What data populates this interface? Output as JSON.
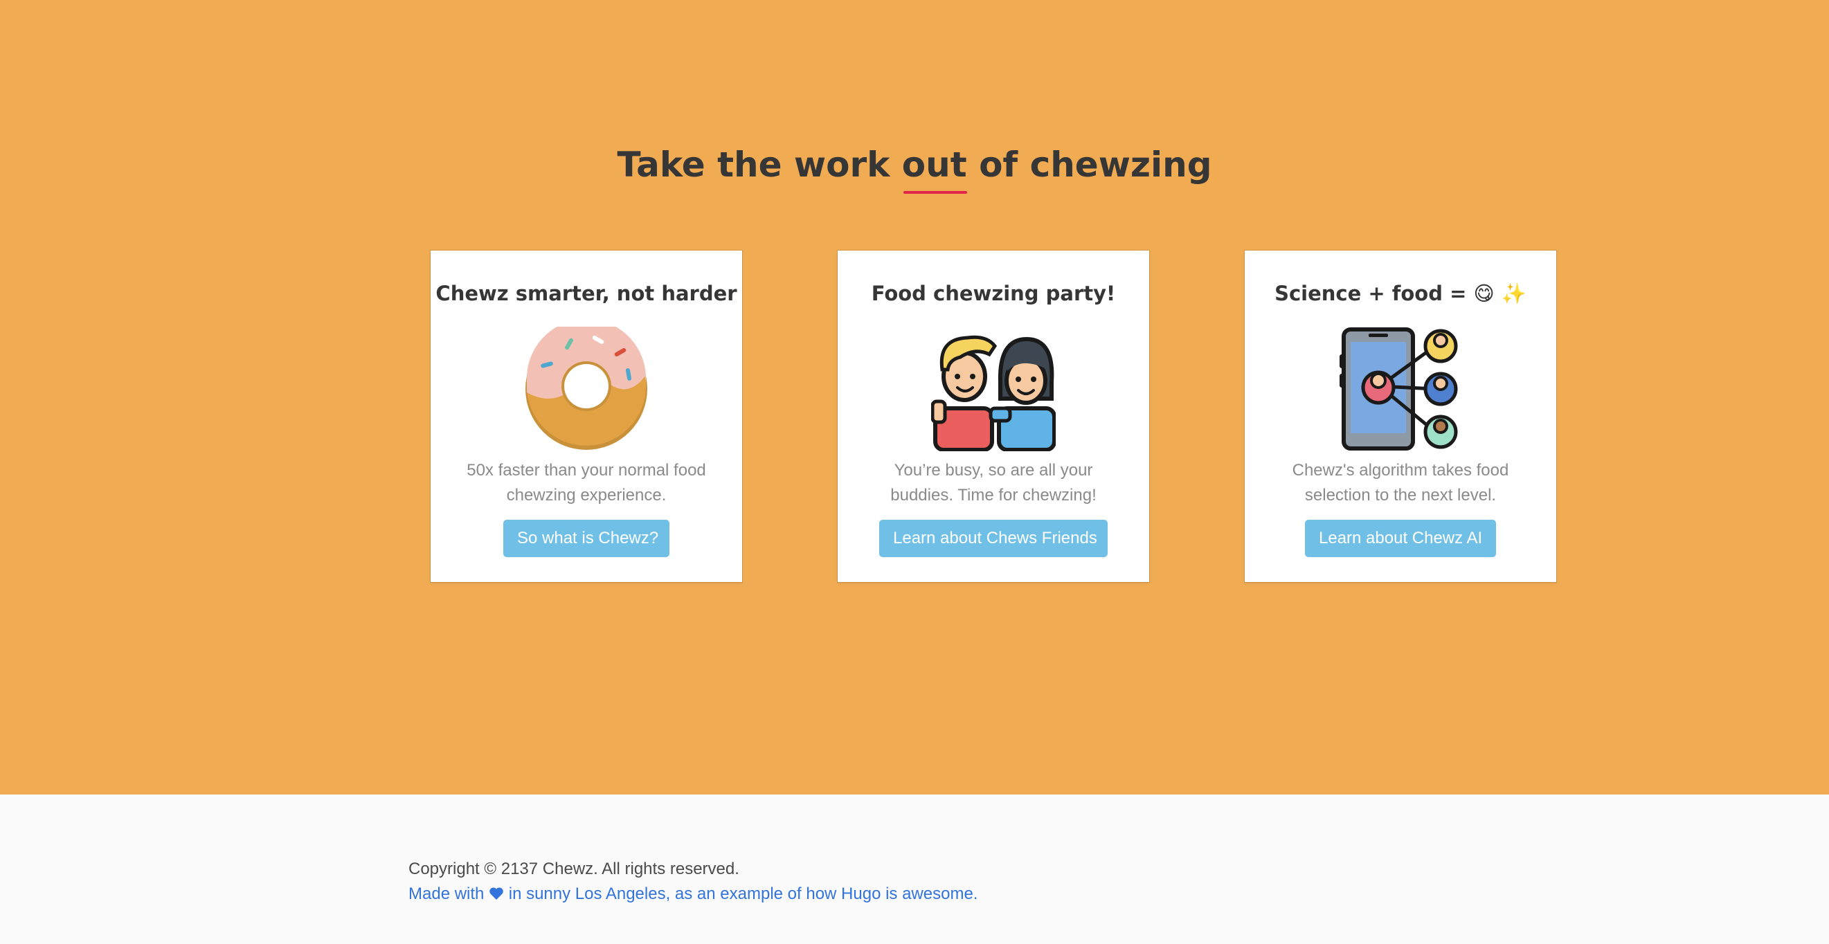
{
  "hero": {
    "title_before": "Take the work",
    "title_underlined": "out",
    "title_after": "of chewzing",
    "background_color": "#f1ab53",
    "underline_color": "#e0244a"
  },
  "cards": [
    {
      "title": "Chewz smarter, not harder",
      "icon": "donut-icon",
      "text": "50x faster than your normal food chewzing experience.",
      "button_label": "So what is Chewz?"
    },
    {
      "title": "Food chewzing party!",
      "icon": "friends-icon",
      "text": "You’re busy, so are all your buddies. Time for chewzing!",
      "button_label": "Learn about Chews Friends"
    },
    {
      "title": "Science + food = 😋 ✨",
      "icon": "network-phone-icon",
      "text": "Chewz's algorithm takes food selection to the next level.",
      "button_label": "Learn about Chewz AI"
    }
  ],
  "button_color": "#6fbfe6",
  "footer": {
    "copyright": "Copyright © 2137 Chewz. All rights reserved.",
    "credit_before": "Made with",
    "credit_icon": "heart-icon",
    "credit_after": "in sunny Los Angeles, as an example of how Hugo is awesome.",
    "link_color": "#3273dc"
  }
}
